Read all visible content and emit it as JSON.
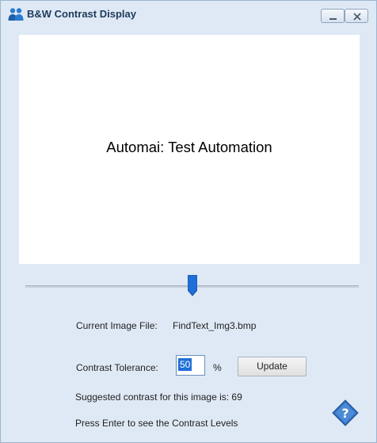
{
  "window": {
    "title": "B&W Contrast Display",
    "app_icon": "users-icon",
    "controls": {
      "minimize_icon": "minimize-icon",
      "close_icon": "close-icon"
    }
  },
  "preview": {
    "text": "Automai: Test Automation"
  },
  "slider": {
    "value_fraction": 0.5
  },
  "file": {
    "label": "Current Image File:",
    "value": "FindText_Img3.bmp"
  },
  "contrast": {
    "label": "Contrast Tolerance:",
    "value": "50",
    "unit": "%",
    "update_label": "Update"
  },
  "suggestion": "Suggested contrast for this image is: 69",
  "instruction": "Press Enter to see the Contrast Levels",
  "help_icon": "help-icon",
  "colors": {
    "window_bg": "#dfe9f5",
    "accent": "#1f6fd8",
    "help_icon": "#2f6fbf"
  }
}
